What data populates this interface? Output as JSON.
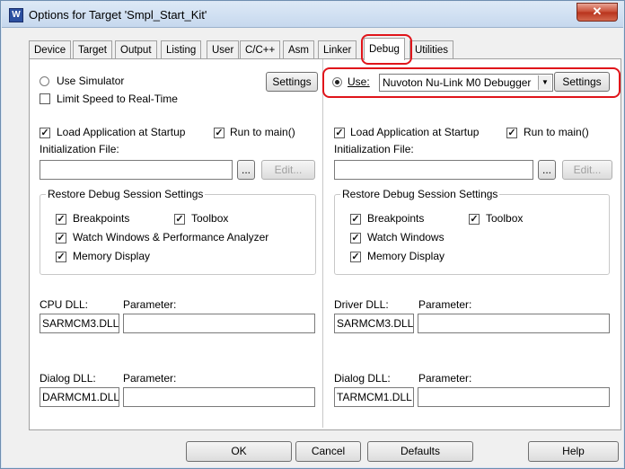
{
  "window": {
    "title": "Options for Target 'Smpl_Start_Kit'",
    "close_glyph": "✕"
  },
  "tabs": [
    "Device",
    "Target",
    "Output",
    "Listing",
    "User",
    "C/C++",
    "Asm",
    "Linker",
    "Debug",
    "Utilities"
  ],
  "active_tab": "Debug",
  "left": {
    "use_simulator": "Use Simulator",
    "limit_speed": "Limit Speed to Real-Time",
    "settings": "Settings",
    "load_app": "Load Application at Startup",
    "run_to_main": "Run to main()",
    "init_file_label": "Initialization File:",
    "browse": "...",
    "edit": "Edit...",
    "restore_title": "Restore Debug Session Settings",
    "breakpoints": "Breakpoints",
    "toolbox": "Toolbox",
    "watch_windows": "Watch Windows & Performance Analyzer",
    "memory_display": "Memory Display",
    "cpu_dll_label": "CPU DLL:",
    "param_label": "Parameter:",
    "cpu_dll_value": "SARMCM3.DLL",
    "dialog_dll_label": "Dialog DLL:",
    "dialog_param_label": "Parameter:",
    "dialog_dll_value": "DARMCM1.DLL"
  },
  "right": {
    "use_label": "Use:",
    "debugger": "Nuvoton Nu-Link M0 Debugger",
    "settings": "Settings",
    "load_app": "Load Application at Startup",
    "run_to_main": "Run to main()",
    "init_file_label": "Initialization File:",
    "browse": "...",
    "edit": "Edit...",
    "restore_title": "Restore Debug Session Settings",
    "breakpoints": "Breakpoints",
    "toolbox": "Toolbox",
    "watch_windows": "Watch Windows",
    "memory_display": "Memory Display",
    "driver_dll_label": "Driver DLL:",
    "param_label": "Parameter:",
    "driver_dll_value": "SARMCM3.DLL",
    "dialog_dll_label": "Dialog DLL:",
    "dialog_param_label": "Parameter:",
    "dialog_dll_value": "TARMCM1.DLL"
  },
  "footer": {
    "ok": "OK",
    "cancel": "Cancel",
    "defaults": "Defaults",
    "help": "Help"
  },
  "checkmark": "✓",
  "accent_color": "#e0141a"
}
